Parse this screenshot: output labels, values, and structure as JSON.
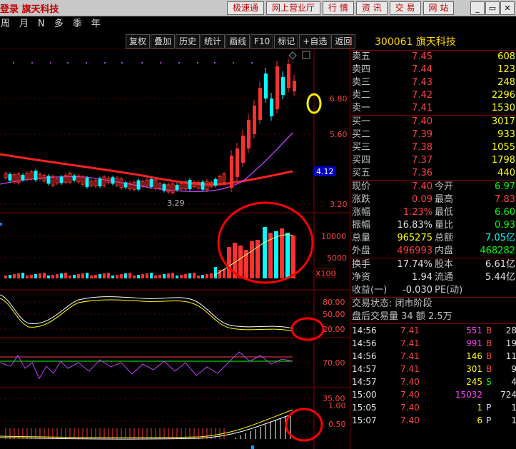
{
  "topbar": {
    "title": "登录  旗天科技",
    "buttons": [
      "极速通",
      "网上营业厅",
      "行  情",
      "资  讯",
      "交  易",
      "网  站"
    ]
  },
  "periods": [
    "周",
    "月",
    "N",
    "多",
    "季",
    "年"
  ],
  "toolbar": [
    "复权",
    "叠加",
    "历史",
    "统计",
    "画线",
    "F10",
    "标记",
    "+自选",
    "返回"
  ],
  "chart_labels": {
    "price_ticks": [
      "6.80",
      "5.60",
      "3.20"
    ],
    "current_price_tag": "4.12",
    "low_label": "3.29",
    "vol_ticks": [
      "10000",
      "5000"
    ],
    "vol_unit": "X100",
    "kdj_ticks": [
      "80.00",
      "50.00",
      "20.00"
    ],
    "rsi_ticks": [
      "70.00",
      "35.00"
    ],
    "bottom_ticks": [
      "1.00",
      "0.50"
    ]
  },
  "quote": {
    "header": "300061  旗天科技",
    "asks": [
      {
        "label": "卖五",
        "price": "7.45",
        "vol": "608"
      },
      {
        "label": "卖四",
        "price": "7.44",
        "vol": "123"
      },
      {
        "label": "卖三",
        "price": "7.43",
        "vol": "248"
      },
      {
        "label": "卖二",
        "price": "7.42",
        "vol": "2296"
      },
      {
        "label": "卖一",
        "price": "7.41",
        "vol": "1530"
      }
    ],
    "bids": [
      {
        "label": "买一",
        "price": "7.40",
        "vol": "3017"
      },
      {
        "label": "买二",
        "price": "7.39",
        "vol": "933"
      },
      {
        "label": "买三",
        "price": "7.38",
        "vol": "1055"
      },
      {
        "label": "买四",
        "price": "7.37",
        "vol": "1798"
      },
      {
        "label": "买五",
        "price": "7.36",
        "vol": "440"
      }
    ],
    "stats": [
      {
        "l": "现价",
        "v": "7.40",
        "vc": "red",
        "l2": "今开",
        "v2": "6.97",
        "v2c": "green"
      },
      {
        "l": "涨跌",
        "v": "0.09",
        "vc": "red",
        "l2": "最高",
        "v2": "7.83",
        "v2c": "red"
      },
      {
        "l": "涨幅",
        "v": "1.23%",
        "vc": "red",
        "l2": "最低",
        "v2": "6.60",
        "v2c": "green"
      },
      {
        "l": "振幅",
        "v": "16.83%",
        "vc": "white",
        "l2": "量比",
        "v2": "0.93",
        "v2c": "green"
      },
      {
        "l": "总量",
        "v": "965275",
        "vc": "yellow",
        "l2": "总额",
        "v2": "7.05亿",
        "v2c": "cyan"
      },
      {
        "l": "外盘",
        "v": "496993",
        "vc": "red",
        "l2": "内盘",
        "v2": "468282",
        "v2c": "green"
      }
    ],
    "stats2": [
      {
        "l": "换手",
        "v": "17.74%",
        "l2": "股本",
        "v2": "6.61亿"
      },
      {
        "l": "净资",
        "v": "1.94",
        "l2": "流通",
        "v2": "5.44亿"
      },
      {
        "l": "收益(一)",
        "v": "-0.030",
        "l2": "PE(动)",
        "v2": ""
      }
    ],
    "status": "交易状态: 闭市阶段",
    "after_hours": "盘后交易量 34 额 2.5万",
    "ticks": [
      {
        "t": "14:56",
        "p": "7.41",
        "v": "551",
        "vc": "magenta",
        "d": "B",
        "dc": "red",
        "n": "28"
      },
      {
        "t": "14:56",
        "p": "7.41",
        "v": "991",
        "vc": "magenta",
        "d": "B",
        "dc": "red",
        "n": "19"
      },
      {
        "t": "14:56",
        "p": "7.41",
        "v": "146",
        "vc": "yellow",
        "d": "B",
        "dc": "red",
        "n": "11"
      },
      {
        "t": "14:57",
        "p": "7.41",
        "v": "301",
        "vc": "yellow",
        "d": "B",
        "dc": "red",
        "n": "9"
      },
      {
        "t": "14:57",
        "p": "7.40",
        "v": "245",
        "vc": "yellow",
        "d": "S",
        "dc": "green",
        "n": "4"
      },
      {
        "t": "15:00",
        "p": "7.40",
        "v": "15032",
        "vc": "magenta",
        "d": "",
        "dc": "white",
        "n": "724"
      },
      {
        "t": "15:05",
        "p": "7.40",
        "v": "1",
        "vc": "yellow",
        "d": "P",
        "dc": "white",
        "n": "1"
      },
      {
        "t": "15:07",
        "p": "7.40",
        "v": "6",
        "vc": "yellow",
        "d": "P",
        "dc": "white",
        "n": "1"
      }
    ]
  },
  "colors": {
    "up": "#ff3030",
    "down": "#00ffff",
    "ma_slow": "#ff2020",
    "ma_fast": "#c040ff",
    "annotation_red": "#ff0000",
    "annotation_yellow": "#ffee00"
  }
}
